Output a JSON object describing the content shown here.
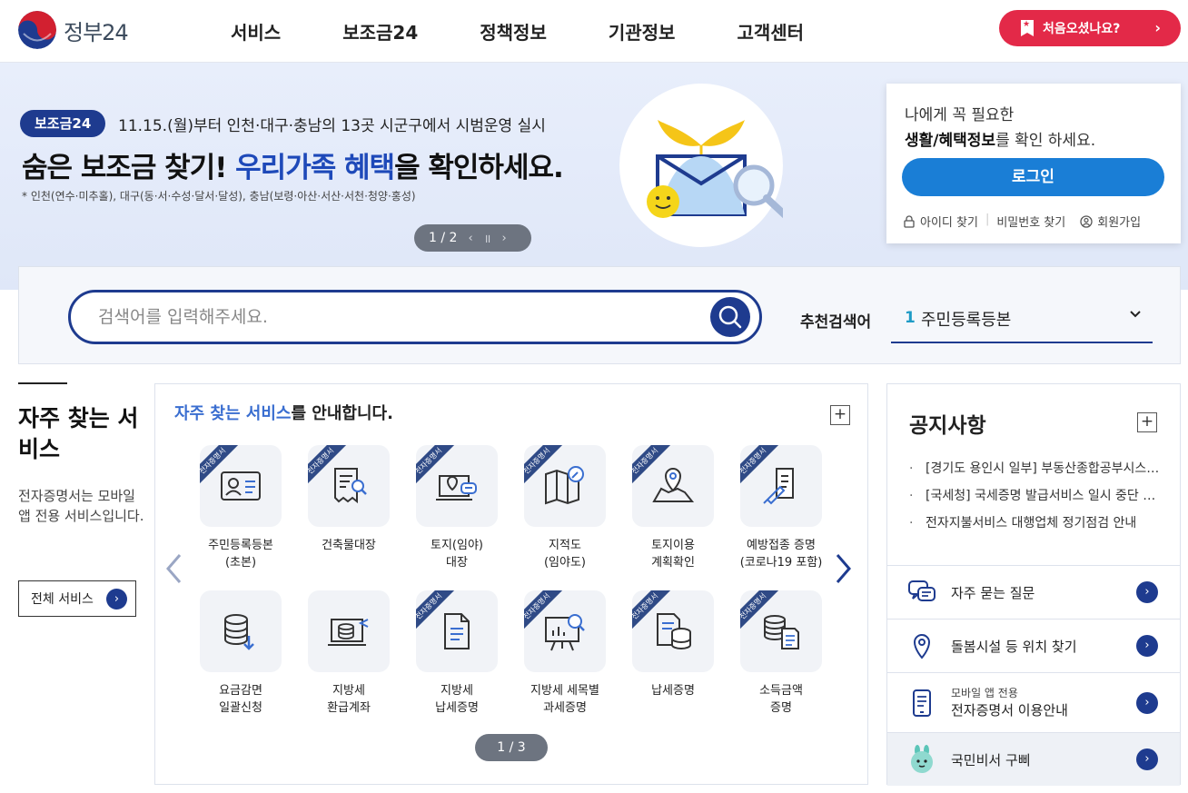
{
  "header": {
    "logo_text": "정부24",
    "nav": [
      "서비스",
      "보조금24",
      "정책정보",
      "기관정보",
      "고객센터"
    ],
    "first_visit": "처음오셨나요?"
  },
  "banner": {
    "badge": "보조금24",
    "subtitle": "11.15.(월)부터 인천·대구·충남의 13곳 시군구에서 시범운영 실시",
    "title_a": "숨은 보조금 찾기! ",
    "title_hl": "우리가족 혜택",
    "title_b": "을 확인하세요.",
    "note": "* 인천(연수·미추홀), 대구(동·서·수성·달서·달성), 충남(보령·아산·서산·서천·청양·홍성)",
    "pager": "1 / 2"
  },
  "login": {
    "line1": "나에게 꼭 필요한",
    "line2_bold": "생활/혜택정보",
    "line2_rest": "를 확인 하세요.",
    "button": "로그인",
    "find_id": "아이디 찾기",
    "find_pw": "비밀번호 찾기",
    "signup": "회원가입"
  },
  "search": {
    "placeholder": "검색어를 입력해주세요.",
    "rec_label": "추천검색어",
    "rec_num": "1",
    "rec_value": "주민등록등본"
  },
  "freq": {
    "title": "자주 찾는 서비스",
    "desc": "전자증명서는 모바일 앱 전용 서비스입니다.",
    "all_button": "전체 서비스"
  },
  "services": {
    "head_hl": "자주 찾는 서비스",
    "head_rest": "를 안내합니다.",
    "ribbon": "전자증명서",
    "items": [
      {
        "l1": "주민등록등본",
        "l2": "(초본)",
        "ribbon": true,
        "icon": "id-card-icon"
      },
      {
        "l1": "건축물대장",
        "l2": "",
        "ribbon": true,
        "icon": "document-search-icon"
      },
      {
        "l1": "토지(임야)",
        "l2": "대장",
        "ribbon": true,
        "icon": "land-laptop-icon"
      },
      {
        "l1": "지적도",
        "l2": "(임야도)",
        "ribbon": true,
        "icon": "map-compass-icon"
      },
      {
        "l1": "토지이용",
        "l2": "계획확인",
        "ribbon": true,
        "icon": "map-pin-icon"
      },
      {
        "l1": "예방접종 증명",
        "l2": "(코로나19 포함)",
        "ribbon": true,
        "icon": "syringe-doc-icon"
      },
      {
        "l1": "요금감면",
        "l2": "일괄신청",
        "ribbon": false,
        "icon": "database-download-icon"
      },
      {
        "l1": "지방세",
        "l2": "환급계좌",
        "ribbon": false,
        "icon": "laptop-coins-icon"
      },
      {
        "l1": "지방세",
        "l2": "납세증명",
        "ribbon": true,
        "icon": "tax-doc-icon"
      },
      {
        "l1": "지방세 세목별",
        "l2": "과세증명",
        "ribbon": true,
        "icon": "presentation-icon"
      },
      {
        "l1": "납세증명",
        "l2": "",
        "ribbon": true,
        "icon": "doc-coins-icon"
      },
      {
        "l1": "소득금액",
        "l2": "증명",
        "ribbon": true,
        "icon": "coins-doc-icon"
      }
    ],
    "pager": "1 / 3"
  },
  "notice": {
    "title": "공지사항",
    "items": [
      "[경기도 용인시 일부] 부동산종합공부시스템 서비스 일시 중단 안내",
      "[국세청] 국세증명 발급서비스 일시 중단 안내",
      "전자지불서비스 대행업체 정기점검 안내"
    ],
    "links": [
      {
        "text": "자주 묻는 질문",
        "small": "",
        "icon": "chat-icon"
      },
      {
        "text": "돌봄시설 등 위치 찾기",
        "small": "",
        "icon": "location-icon"
      },
      {
        "text": "전자증명서 이용안내",
        "small": "모바일 앱 전용",
        "icon": "mobile-doc-icon"
      },
      {
        "text": "국민비서 구삐",
        "small": "",
        "icon": "gubbi-mascot-icon"
      }
    ]
  },
  "colors": {
    "primary": "#1e3b8f",
    "accent_red": "#e32948",
    "login_blue": "#1a7ed6",
    "banner_bg": "#e3eafa"
  }
}
